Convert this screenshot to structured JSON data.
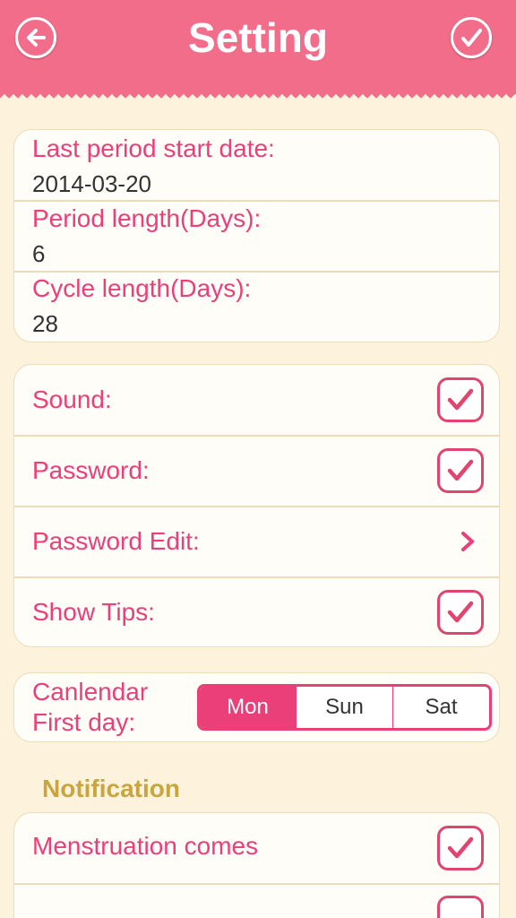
{
  "header": {
    "title": "Setting",
    "back_icon": "back-arrow-icon",
    "confirm_icon": "checkmark-icon"
  },
  "period": {
    "last_start_label": "Last period start date:",
    "last_start_value": "2014-03-20",
    "length_label": "Period length(Days):",
    "length_value": "6",
    "cycle_label": "Cycle length(Days):",
    "cycle_value": "28"
  },
  "toggles": {
    "sound_label": "Sound:",
    "sound_checked": true,
    "password_label": "Password:",
    "password_checked": true,
    "password_edit_label": "Password Edit:",
    "show_tips_label": "Show Tips:",
    "show_tips_checked": true
  },
  "calendar": {
    "label": "Canlendar First day:",
    "options": [
      "Mon",
      "Sun",
      "Sat"
    ],
    "selected": "Mon"
  },
  "notification": {
    "section_title": "Notification",
    "menstruation_label": "Menstruation comes",
    "menstruation_checked": true
  },
  "colors": {
    "header": "#f26d8a",
    "accent": "#ea3f79",
    "section": "#c9a540",
    "background": "#fdf3dc"
  }
}
